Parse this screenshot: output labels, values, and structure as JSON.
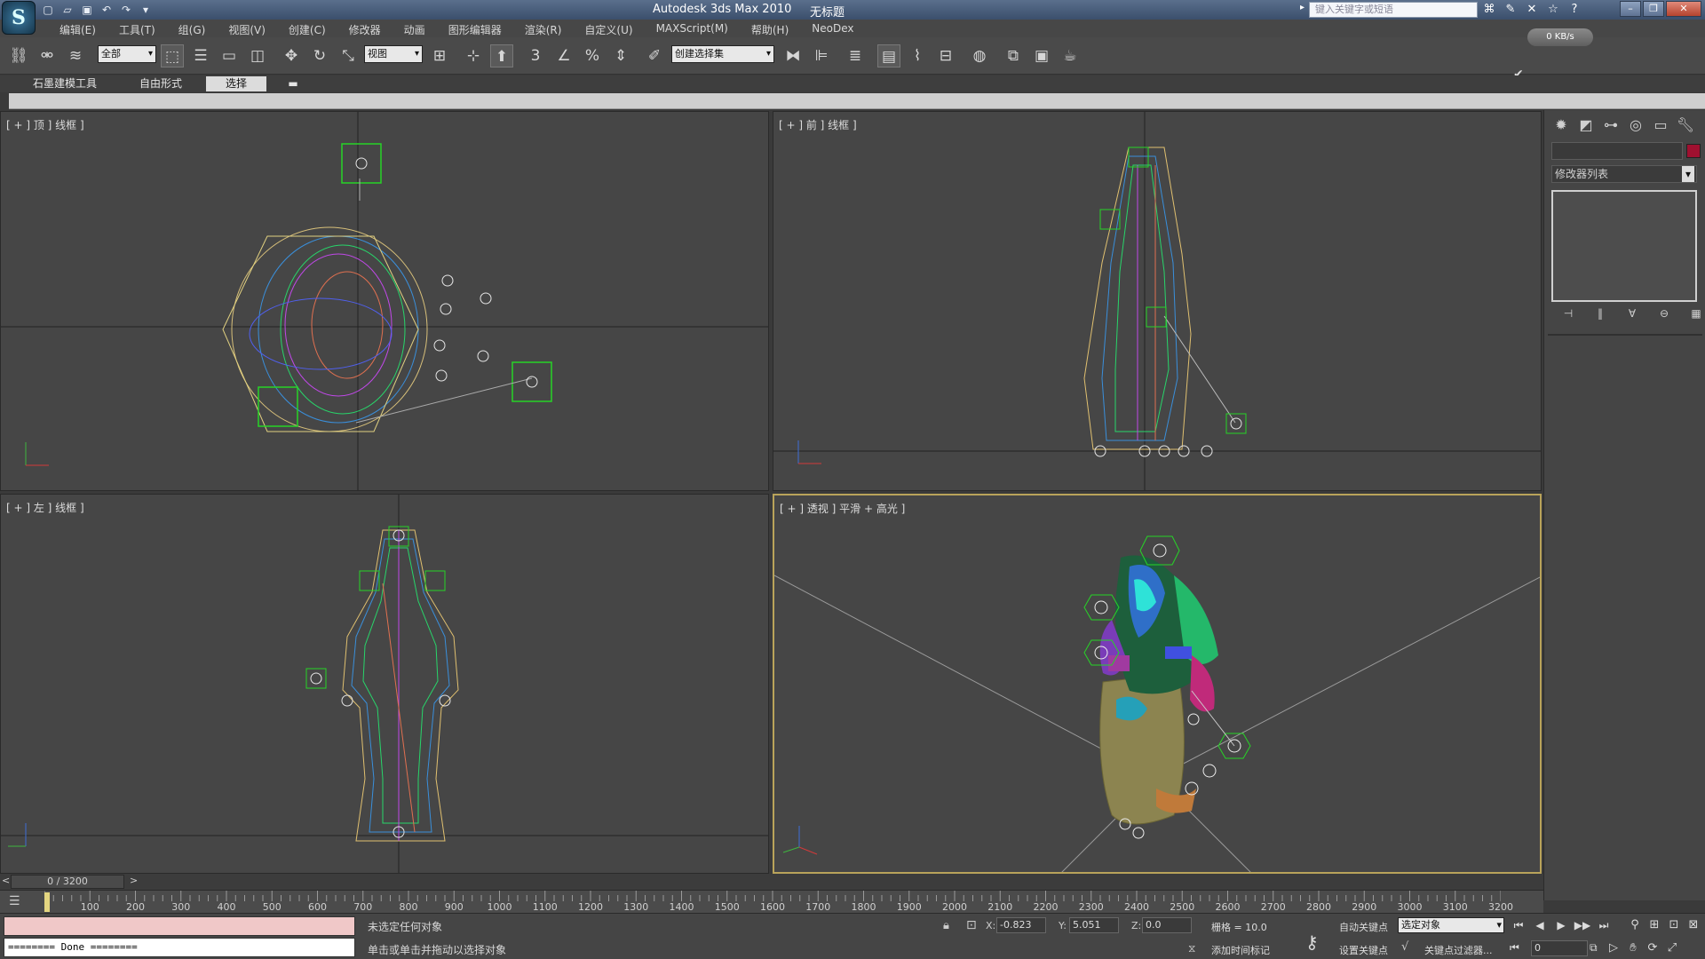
{
  "title_bar": {
    "app_name": "Autodesk 3ds Max  2010",
    "document": "无标题",
    "search_placeholder": "键入关键字或短语",
    "logo_letter": "S"
  },
  "menu": [
    "编辑(E)",
    "工具(T)",
    "组(G)",
    "视图(V)",
    "创建(C)",
    "修改器",
    "动画",
    "图形编辑器",
    "渲染(R)",
    "自定义(U)",
    "MAXScript(M)",
    "帮助(H)",
    "NeoDex"
  ],
  "toolbar": {
    "selection_filter": "全部",
    "reference_coord": "视图",
    "named_selection": "创建选择集",
    "net_speed": "0 KB/s"
  },
  "ribbon": {
    "tabs": [
      {
        "label": "石墨建模工具",
        "active": false
      },
      {
        "label": "自由形式",
        "active": false
      },
      {
        "label": "选择",
        "active": true
      }
    ],
    "toggle_icon": "panel-toggle-icon"
  },
  "viewports": {
    "top": {
      "label": "[ + ] 顶 ] 线框 ]"
    },
    "front": {
      "label": "[ + ] 前 ] 线框 ]"
    },
    "left": {
      "label": "[ + ] 左 ] 线框 ]"
    },
    "perspective": {
      "label": "[ + ] 透视 ] 平滑 + 高光 ]",
      "active": true
    }
  },
  "command_panel": {
    "tabs": [
      "create-icon",
      "modify-icon",
      "hierarchy-icon",
      "motion-icon",
      "display-icon",
      "utilities-icon"
    ],
    "modifier_list": "修改器列表",
    "object_color": "#a01030"
  },
  "time_slider": {
    "position": "0 / 3200",
    "prev": "<",
    "next": ">"
  },
  "trackbar": {
    "labels": [
      "100",
      "200",
      "300",
      "400",
      "500",
      "600",
      "700",
      "800",
      "900",
      "1000",
      "1100",
      "1200",
      "1300",
      "1400",
      "1500",
      "1600",
      "1700",
      "1800",
      "1900",
      "2000",
      "2100",
      "2200",
      "2300",
      "2400",
      "2500",
      "2600",
      "2700",
      "2800",
      "2900",
      "3000",
      "3100",
      "3200"
    ]
  },
  "status": {
    "listener_output": "======== Done ========",
    "message": "未选定任何对象",
    "prompt": "单击或单击并拖动以选择对象",
    "x_label": "X:",
    "x_value": "-0.823",
    "y_label": "Y:",
    "y_value": "5.051",
    "z_label": "Z:",
    "z_value": "0.0",
    "grid": "栅格 = 10.0",
    "add_time_tag": "添加时间标记",
    "auto_key": "自动关键点",
    "set_key": "设置关键点",
    "selected_dropdown": "选定对象",
    "key_filters": "关键点过滤器...",
    "current_frame": "0"
  }
}
